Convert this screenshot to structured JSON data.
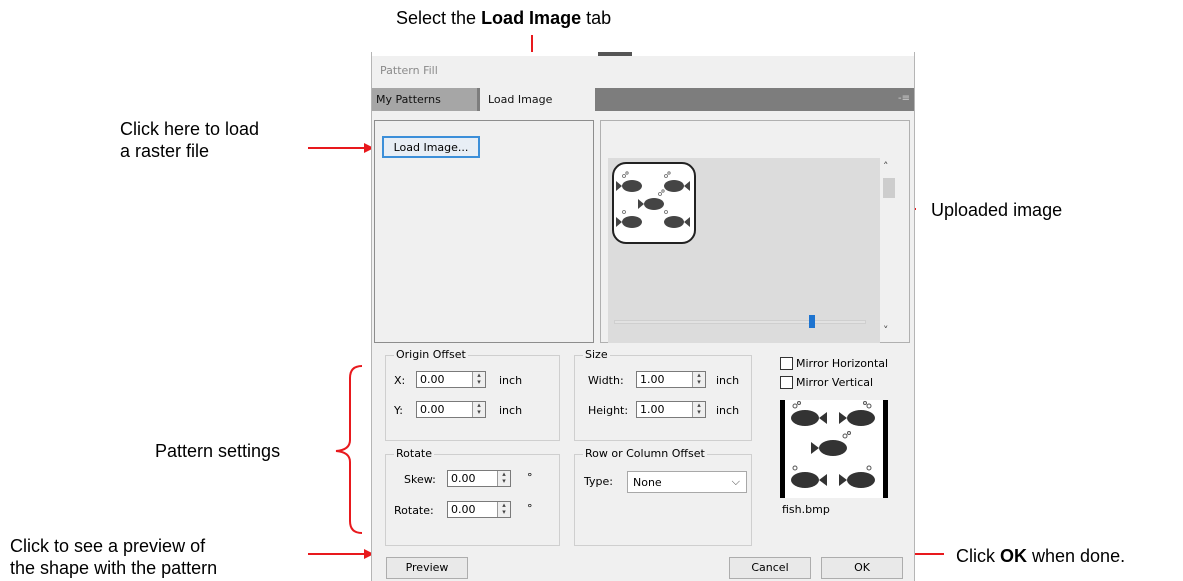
{
  "annotations": {
    "select_tab_pre": "Select the ",
    "select_tab_bold": "Load Image",
    "select_tab_post": " tab",
    "load_raster_line1": "Click here to load",
    "load_raster_line2": "a raster file",
    "uploaded_image": "Uploaded image",
    "pattern_settings": "Pattern settings",
    "preview_line1": "Click to see a preview of",
    "preview_line2": "the shape with the pattern",
    "ok_pre": "Click ",
    "ok_bold": "OK",
    "ok_post": " when done."
  },
  "dialog": {
    "title": "Pattern Fill",
    "tabs": [
      {
        "label": "My Patterns",
        "active": false
      },
      {
        "label": "Load Image",
        "active": true
      }
    ],
    "tab_menu_icon": "-≡",
    "load_image_button": "Load Image...",
    "origin_offset": {
      "label": "Origin Offset",
      "x_label": "X:",
      "x_value": "0.00",
      "x_unit": "inch",
      "y_label": "Y:",
      "y_value": "0.00",
      "y_unit": "inch"
    },
    "size": {
      "label": "Size",
      "width_label": "Width:",
      "width_value": "1.00",
      "width_unit": "inch",
      "height_label": "Height:",
      "height_value": "1.00",
      "height_unit": "inch"
    },
    "rotate": {
      "label": "Rotate",
      "skew_label": "Skew:",
      "skew_value": "0.00",
      "skew_unit": "°",
      "rotate_label": "Rotate:",
      "rotate_value": "0.00",
      "rotate_unit": "°"
    },
    "row_col_offset": {
      "label": "Row or Column Offset",
      "type_label": "Type:",
      "type_value": "None"
    },
    "mirror_horizontal": {
      "label": "Mirror Horizontal",
      "checked": false
    },
    "mirror_vertical": {
      "label": "Mirror Vertical",
      "checked": false
    },
    "file_name": "fish.bmp",
    "preview_button": "Preview",
    "cancel_button": "Cancel",
    "ok_button": "OK"
  },
  "colors": {
    "arrow": "#e8191d",
    "accent": "#1e74d0"
  }
}
